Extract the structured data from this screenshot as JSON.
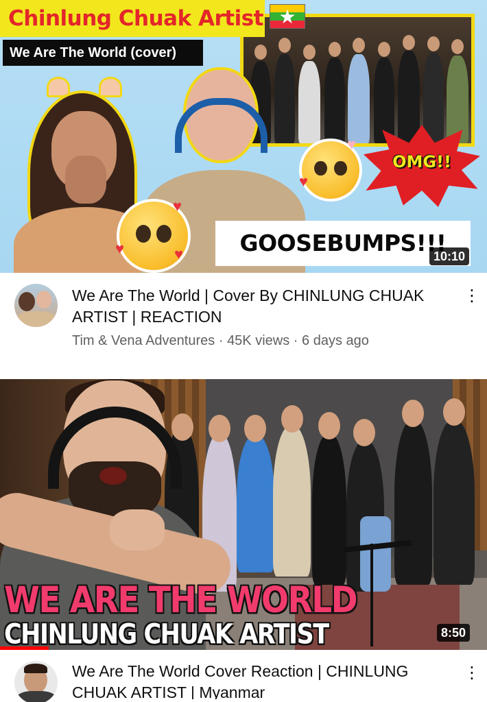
{
  "videos": [
    {
      "thumbnail": {
        "title_banner": "Chinlung Chuak Artist",
        "subtitle_banner": "We Are The World (cover)",
        "sticker_omg": "OMG!!",
        "sticker_goosebumps": "GOOSEBUMPS!!!",
        "flag": "myanmar-flag",
        "duration": "10:10"
      },
      "title": "We Are The World | Cover By CHINLUNG CHUAK ARTIST | REACTION",
      "channel": "Tim & Vena Adventures",
      "views": "45K views",
      "age": "6 days ago",
      "separator": "·",
      "menu_icon": "⋮"
    },
    {
      "thumbnail": {
        "headline": "WE ARE THE WORLD",
        "subheadline": "CHINLUNG CHUAK ARTIST",
        "duration": "8:50",
        "progress": 0.1
      },
      "title": "We Are The World Cover Reaction | CHINLUNG CHUAK ARTIST | Myanmar",
      "menu_icon": "⋮"
    }
  ],
  "colors": {
    "banner_yellow": "#f2e71c",
    "banner_red": "#e3262a",
    "headline_pink": "#f23b6d",
    "progress_red": "#ff0000",
    "meta_gray": "#606060"
  }
}
